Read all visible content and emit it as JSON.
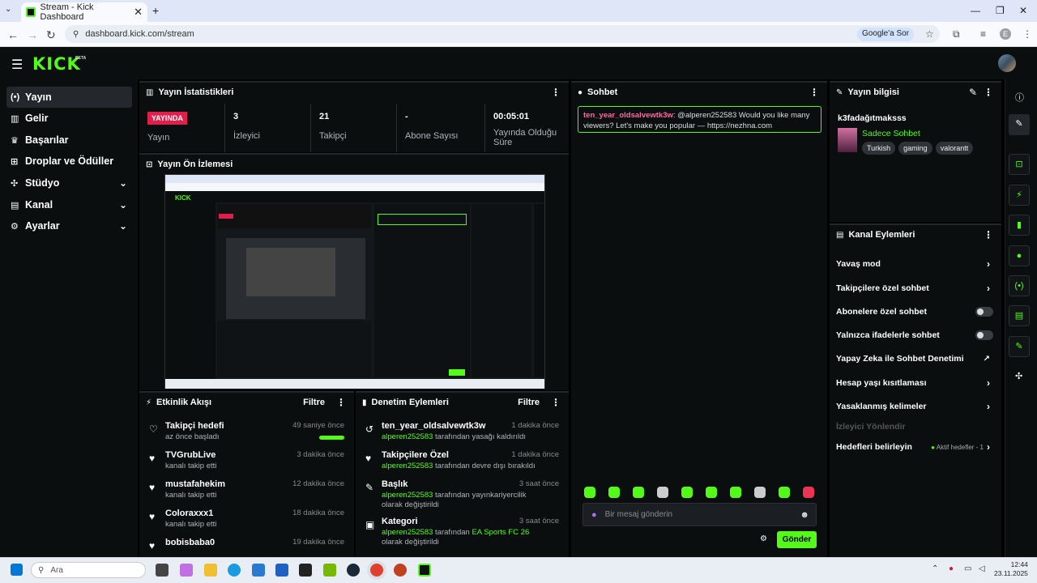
{
  "browser": {
    "tab_title": "Stream - Kick Dashboard",
    "tab_close": "✕",
    "new_tab": "+",
    "tab_menu": "⌄",
    "url": "dashboard.kick.com/stream",
    "google_chip": "Google'a Sor",
    "profile_initial": "E",
    "win_min": "—",
    "win_max": "❐",
    "win_close": "✕"
  },
  "header": {
    "logo": "KICK",
    "beta": "BETA"
  },
  "sidebar": {
    "items": [
      {
        "label": "Yayın",
        "icon": "broadcast-icon",
        "glyph": "((•))"
      },
      {
        "label": "Gelir",
        "icon": "chart-icon",
        "glyph": "▥"
      },
      {
        "label": "Başarılar",
        "icon": "trophy-icon",
        "glyph": "🏆"
      },
      {
        "label": "Droplar ve Ödüller",
        "icon": "gift-icon",
        "glyph": "🎁"
      },
      {
        "label": "Stüdyo",
        "icon": "studio-icon",
        "glyph": "✣"
      },
      {
        "label": "Kanal",
        "icon": "channel-icon",
        "glyph": "▤"
      },
      {
        "label": "Ayarlar",
        "icon": "gear-icon",
        "glyph": "⚙"
      }
    ]
  },
  "stats": {
    "title": "Yayın İstatistikleri",
    "live_badge": "YAYINDA",
    "live_label": "Yayın",
    "viewers_value": "3",
    "viewers_label": "İzleyici",
    "followers_value": "21",
    "followers_label": "Takipçi",
    "subs_value": "-",
    "subs_label": "Abone Sayısı",
    "uptime_value": "00:05:01",
    "uptime_label": "Yayında Olduğu Süre"
  },
  "preview": {
    "title": "Yayın Ön İzlemesi"
  },
  "activity": {
    "title": "Etkinlik Akışı",
    "filter": "Filtre",
    "rows": [
      {
        "title": "Takipçi hedefi",
        "sub": "az önce başladı",
        "time": "49 saniye önce"
      },
      {
        "title": "TVGrubLive",
        "sub": "kanalı takip etti",
        "time": "3 dakika önce"
      },
      {
        "title": "mustafahekim",
        "sub": "kanalı takip etti",
        "time": "12 dakika önce"
      },
      {
        "title": "Coloraxxx1",
        "sub": "kanalı takip etti",
        "time": "18 dakika önce"
      },
      {
        "title": "bobisbaba0",
        "sub": "kanalı takip etti",
        "time": "19 dakika önce"
      }
    ]
  },
  "moderation": {
    "title": "Denetim Eylemleri",
    "filter": "Filtre",
    "rows": [
      {
        "title": "ten_year_oldsalvewtk3w",
        "user": "alperen252583",
        "sub": " tarafından yasağı kaldırıldı",
        "time": "1 dakika önce"
      },
      {
        "title": "Takipçilere Özel",
        "user": "alperen252583",
        "sub": " tarafından devre dışı bırakıldı",
        "time": "1 dakika önce"
      },
      {
        "title": "Başlık",
        "user": "alperen252583",
        "sub": " tarafından yayınkariyercilik olarak değiştirildi",
        "time": "3 saat önce"
      },
      {
        "title": "Kategori",
        "user": "alperen252583",
        "sub": " tarafından ",
        "extra": "EA Sports FC 26",
        "sub2": " olarak değiştirildi",
        "time": "3 saat önce"
      }
    ]
  },
  "chat": {
    "title": "Sohbet",
    "message_user": "ten_year_oldsalvewtk3w",
    "message_text": ": @alperen252583 Would you like many viewers? Let's make you popular — https://nezhna.com",
    "input_placeholder": "Bir mesaj gönderin",
    "send": "Gönder"
  },
  "info": {
    "title": "Yayın bilgisi",
    "stream_title": "k3fadağıtmaksss",
    "category": "Sadece Sohbet",
    "tags": [
      "Turkish",
      "gaming",
      "valorantt"
    ]
  },
  "actions": {
    "title": "Kanal Eylemleri",
    "items": [
      {
        "label": "Yavaş mod",
        "type": "arrow"
      },
      {
        "label": "Takipçilere özel sohbet",
        "type": "arrow"
      },
      {
        "label": "Abonelere özel sohbet",
        "type": "toggle"
      },
      {
        "label": "Yalnızca ifadelerle sohbet",
        "type": "toggle"
      },
      {
        "label": "Yapay Zeka ile Sohbet Denetimi",
        "type": "external"
      },
      {
        "label": "Hesap yaşı kısıtlaması",
        "type": "arrow"
      },
      {
        "label": "Yasaklanmış kelimeler",
        "type": "arrow"
      },
      {
        "label": "İzleyici Yönlendir",
        "type": "disabled"
      },
      {
        "label": "Hedefleri belirleyin",
        "type": "goal",
        "extra": "Aktif hedefler - 1"
      }
    ]
  },
  "taskbar": {
    "search": "Ara",
    "time": "12:44",
    "date": "23.11.2025"
  },
  "colors": {
    "accent": "#53fc18",
    "live": "#e0204c",
    "panel": "#0b0e0f"
  }
}
